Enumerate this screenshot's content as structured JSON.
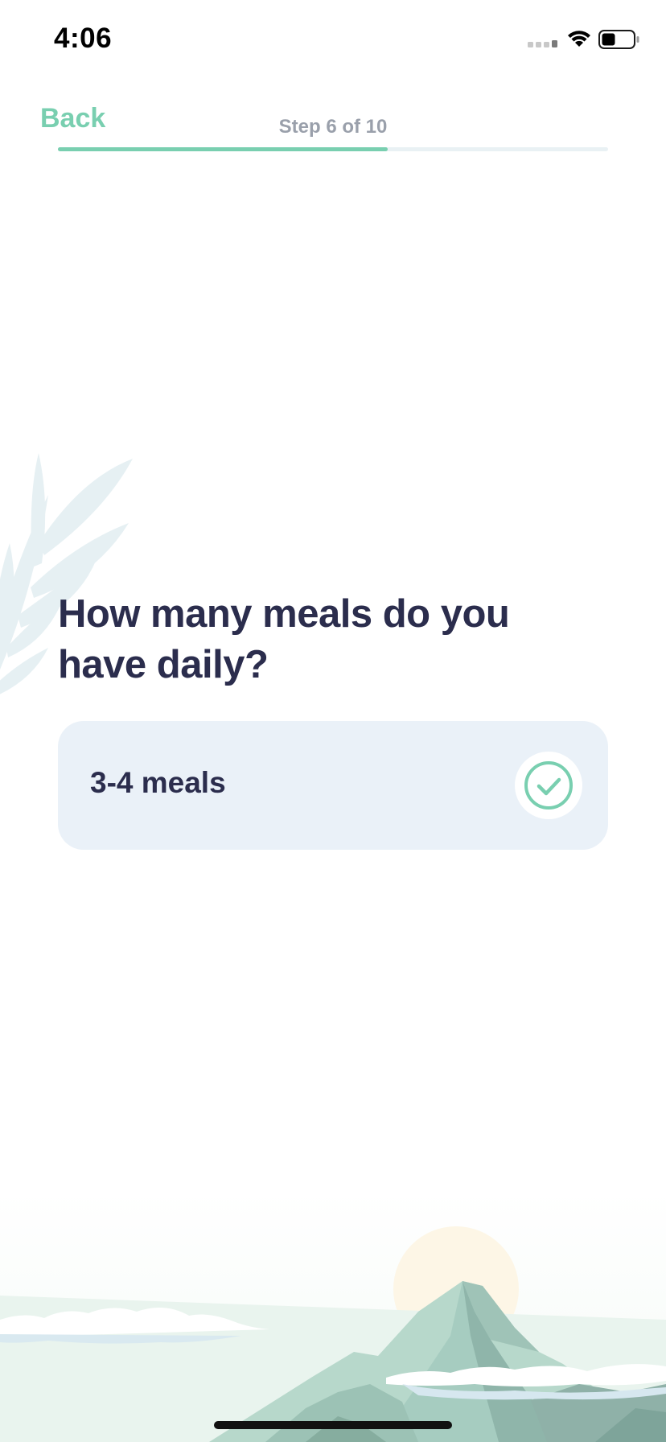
{
  "status_bar": {
    "time": "4:06",
    "icons": [
      "cellular-signal-icon",
      "wifi-icon",
      "battery-icon"
    ]
  },
  "header": {
    "back_label": "Back",
    "step_label": "Step 6 of 10",
    "progress": 0.6
  },
  "question": {
    "title": "How many meals do you have daily?",
    "options": [
      {
        "label": "3-4 meals",
        "selected": true
      }
    ]
  },
  "colors": {
    "accent": "#79cfb0",
    "title_text": "#2b2d4d",
    "card_background": "#eaf1f8",
    "step_text": "#9aa0ab"
  }
}
